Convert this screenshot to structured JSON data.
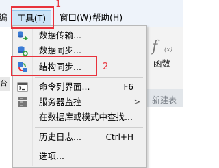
{
  "menubar": {
    "edit_fragment": "编",
    "tools": "工具(T)",
    "window": "窗口(W)",
    "help": "帮助(H)"
  },
  "background": {
    "left_tab": "台",
    "right_label": "函数",
    "right_bar_text": "新建表",
    "func_symbol": "f",
    "func_sub": "(x)"
  },
  "menu": {
    "items": [
      {
        "label": "数据传输...",
        "icon": "data-transfer-icon"
      },
      {
        "label": "数据同步...",
        "icon": "data-sync-icon"
      },
      {
        "label": "结构同步...",
        "icon": "structure-sync-icon"
      },
      {
        "label": "命令列界面...",
        "shortcut": "F6",
        "icon": "console-icon"
      },
      {
        "label": "服务器监控",
        "icon": "server-monitor-icon",
        "submenu": true,
        "arrow": ">"
      },
      {
        "label": "在数据库或模式中查找..."
      },
      {
        "label": "历史日志...",
        "shortcut": "Ctrl+H"
      },
      {
        "label": "选项..."
      }
    ]
  },
  "annotations": {
    "one": "1",
    "two": "2"
  },
  "colors": {
    "highlight": "#e8323c",
    "menu_bg": "#f0f0f0",
    "menubar_bg": "#eef3fa",
    "selected_bg": "#cce4f7"
  }
}
